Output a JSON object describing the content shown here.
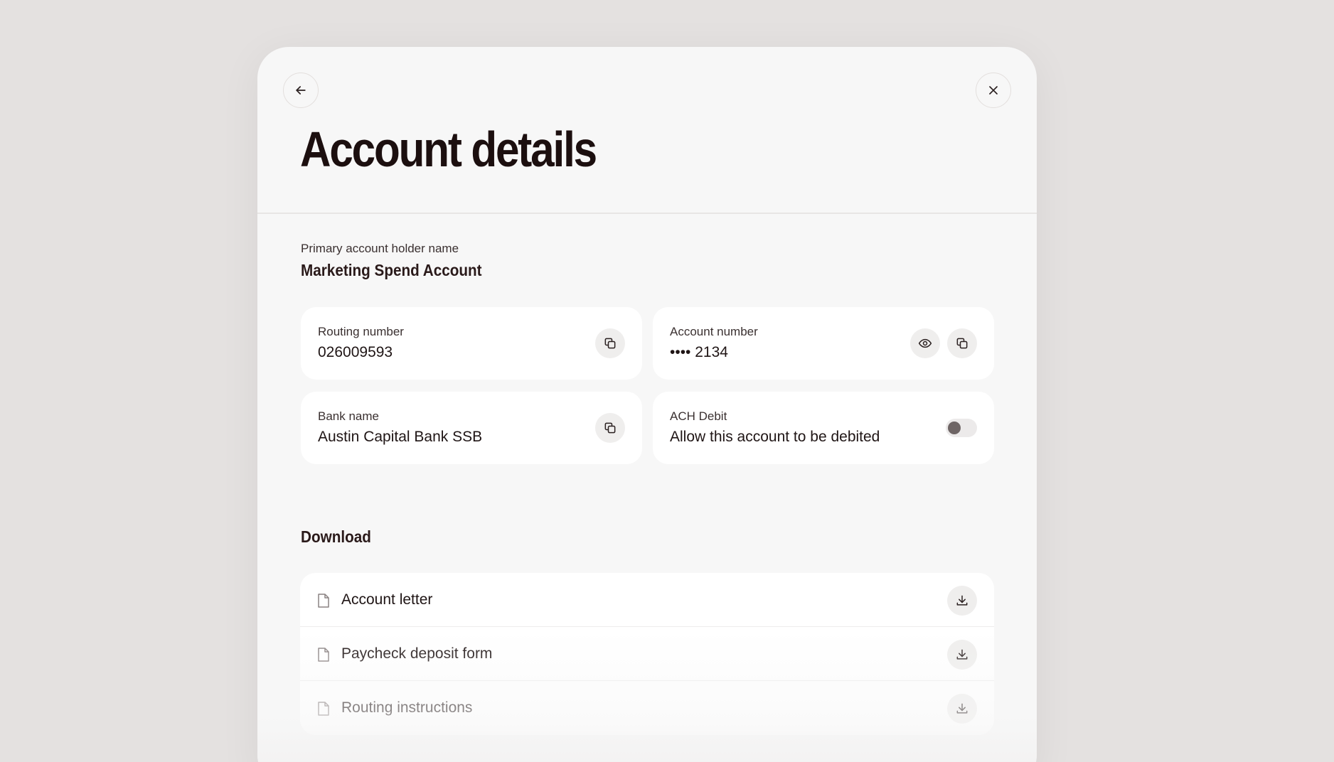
{
  "header": {
    "title": "Account details",
    "back_icon": "arrow-left-icon",
    "close_icon": "close-icon"
  },
  "holder": {
    "label": "Primary account holder name",
    "value": "Marketing Spend Account"
  },
  "details": {
    "routing": {
      "label": "Routing number",
      "value": "026009593",
      "copy_icon": "copy-icon"
    },
    "account": {
      "label": "Account number",
      "value": "•••• 2134",
      "reveal_icon": "eye-icon",
      "copy_icon": "copy-icon"
    },
    "bank": {
      "label": "Bank name",
      "value": "Austin Capital Bank SSB",
      "copy_icon": "copy-icon"
    },
    "ach": {
      "label": "ACH Debit",
      "value": "Allow this account to be debited",
      "enabled": false
    }
  },
  "download": {
    "heading": "Download",
    "items": [
      {
        "label": "Account letter",
        "icon": "file-icon",
        "action_icon": "download-icon"
      },
      {
        "label": "Paycheck deposit form",
        "icon": "file-icon",
        "action_icon": "download-icon"
      },
      {
        "label": "Routing instructions",
        "icon": "file-icon",
        "action_icon": "download-icon"
      }
    ]
  },
  "colors": {
    "background": "#e4e1e0",
    "panel": "#f7f7f7",
    "card": "#ffffff",
    "text": "#1f1515",
    "muted_button": "#efeeed"
  }
}
